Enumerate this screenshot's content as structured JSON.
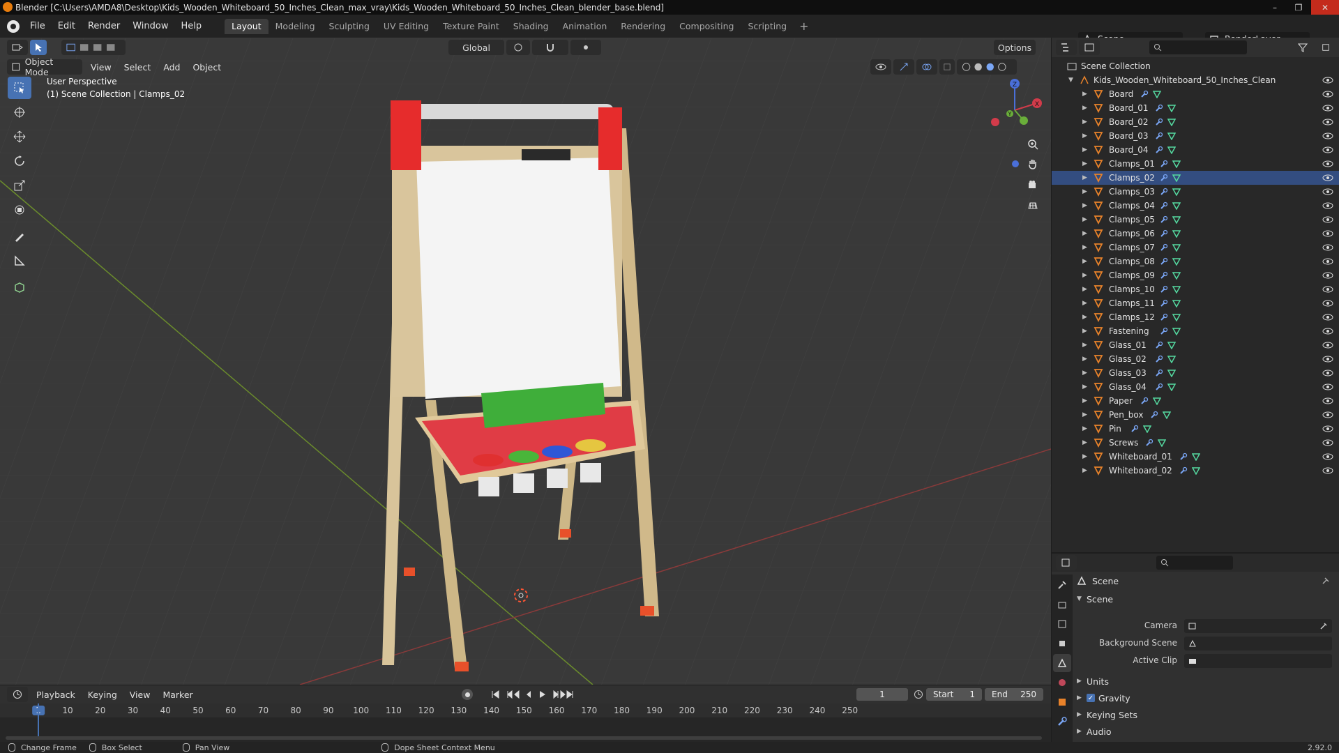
{
  "window": {
    "title": "Blender [C:\\Users\\AMDA8\\Desktop\\Kids_Wooden_Whiteboard_50_Inches_Clean_max_vray\\Kids_Wooden_Whiteboard_50_Inches_Clean_blender_base.blend]",
    "minimize": "–",
    "maximize": "❐",
    "close": "✕"
  },
  "menu": [
    "File",
    "Edit",
    "Render",
    "Window",
    "Help"
  ],
  "workspaces": [
    "Layout",
    "Modeling",
    "Sculpting",
    "UV Editing",
    "Texture Paint",
    "Shading",
    "Animation",
    "Rendering",
    "Compositing",
    "Scripting"
  ],
  "workspace_active": "Layout",
  "workspace_add": "+",
  "scene_name": "Scene",
  "render_layer": "RenderLayer",
  "viewport": {
    "transform_orientation": "Global",
    "options_label": "Options",
    "mode": "Object Mode",
    "menus": [
      "View",
      "Select",
      "Add",
      "Object"
    ],
    "info_line1": "User Perspective",
    "info_line2": "(1) Scene Collection | Clamps_02",
    "gizmo": {
      "x": "X",
      "y": "Y",
      "z": "Z"
    }
  },
  "outliner": {
    "root": "Scene Collection",
    "collection": "Kids_Wooden_Whiteboard_50_Inches_Clean",
    "selected": "Clamps_02",
    "objects": [
      "Board",
      "Board_01",
      "Board_02",
      "Board_03",
      "Board_04",
      "Clamps_01",
      "Clamps_02",
      "Clamps_03",
      "Clamps_04",
      "Clamps_05",
      "Clamps_06",
      "Clamps_07",
      "Clamps_08",
      "Clamps_09",
      "Clamps_10",
      "Clamps_11",
      "Clamps_12",
      "Fastening",
      "Glass_01",
      "Glass_02",
      "Glass_03",
      "Glass_04",
      "Paper",
      "Pen_box",
      "Pin",
      "Screws",
      "Whiteboard_01",
      "Whiteboard_02"
    ]
  },
  "properties": {
    "context": "Scene",
    "panel": "Scene",
    "fields": [
      {
        "label": "Camera",
        "value": ""
      },
      {
        "label": "Background Scene",
        "value": ""
      },
      {
        "label": "Active Clip",
        "value": ""
      }
    ],
    "collapsed_panels": [
      "Units",
      "Gravity",
      "Keying Sets",
      "Audio"
    ],
    "gravity_checked": true
  },
  "timeline": {
    "menus": [
      "Playback",
      "Keying",
      "View",
      "Marker"
    ],
    "current_frame": "1",
    "start_label": "Start",
    "start": "1",
    "end_label": "End",
    "end": "250",
    "ticks": [
      "1",
      "10",
      "20",
      "30",
      "40",
      "50",
      "60",
      "70",
      "80",
      "90",
      "100",
      "110",
      "120",
      "130",
      "140",
      "150",
      "160",
      "170",
      "180",
      "190",
      "200",
      "210",
      "220",
      "230",
      "240",
      "250"
    ]
  },
  "statusbar": {
    "items": [
      "Change Frame",
      "Box Select",
      "Pan View",
      "Dope Sheet Context Menu"
    ],
    "version": "2.92.0"
  },
  "colors": {
    "accent": "#4772b3",
    "selected_row": "#334d80",
    "object_orange": "#e8822a",
    "mesh_green": "#55d9a0",
    "modifier_blue": "#7aa6f5"
  }
}
